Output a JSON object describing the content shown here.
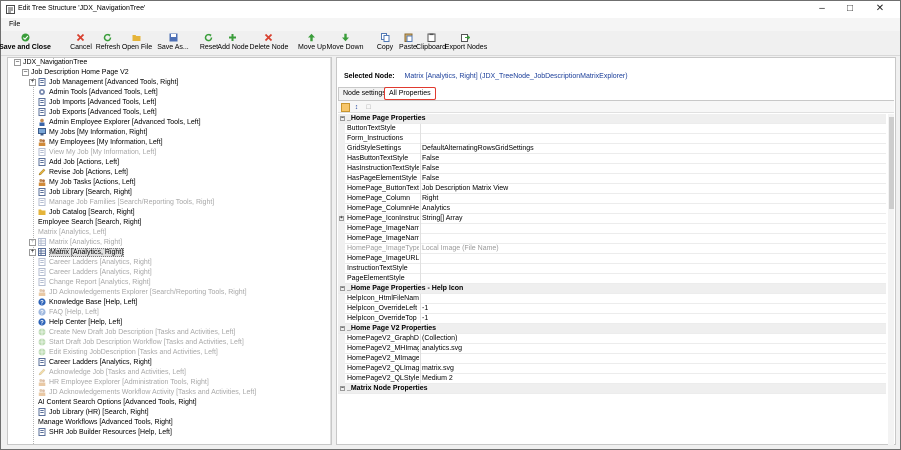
{
  "window": {
    "title": "Edit Tree Structure 'JDX_NavigationTree'"
  },
  "menu": {
    "file": "File"
  },
  "toolbar": [
    {
      "label": "Save and Close",
      "icon": "check-circle-icon",
      "color": "#3a9d3a",
      "bold": true
    },
    {
      "label": "Cancel",
      "icon": "x-icon",
      "color": "#d8412f"
    },
    {
      "label": "Refresh",
      "icon": "refresh-icon",
      "color": "#3a9d3a"
    },
    {
      "label": "Open File",
      "icon": "folder-icon",
      "color": "#e5b43a"
    },
    {
      "label": "Save As...",
      "icon": "floppy-icon",
      "color": "#4d6fb5"
    },
    {
      "label": "Reset",
      "icon": "refresh-icon",
      "color": "#3a9d3a"
    },
    {
      "label": "Add Node",
      "icon": "plus-icon",
      "color": "#3a9d3a"
    },
    {
      "label": "Delete Node",
      "icon": "x-icon",
      "color": "#d8412f"
    },
    {
      "label": "Move Up",
      "icon": "arrow-up-icon",
      "color": "#3a9d3a"
    },
    {
      "label": "Move Down",
      "icon": "arrow-down-icon",
      "color": "#3a9d3a"
    },
    {
      "label": "Copy",
      "icon": "copy-icon",
      "color": "#5078b4"
    },
    {
      "label": "Paste",
      "icon": "paste-icon",
      "color": "#5078b4"
    },
    {
      "label": "Clipboard",
      "icon": "clipboard-icon",
      "color": "#555555"
    },
    {
      "label": "Export Nodes",
      "icon": "export-icon",
      "color": "#555555"
    }
  ],
  "tree": {
    "root": "JDX_NavigationTree",
    "parent": "Job Description Home Page V2",
    "items": [
      {
        "label": "Job Management [Advanced Tools, Right]",
        "icon": "doc-icon",
        "expandable": true,
        "disabled": false
      },
      {
        "label": "Admin Tools [Advanced Tools, Left]",
        "icon": "gear-icon",
        "expandable": false,
        "disabled": false
      },
      {
        "label": "Job Imports [Advanced Tools, Left]",
        "icon": "doc-icon",
        "expandable": false,
        "disabled": false
      },
      {
        "label": "Job Exports [Advanced Tools, Left]",
        "icon": "doc-icon",
        "expandable": false,
        "disabled": false
      },
      {
        "label": "Admin Employee Explorer [Advanced Tools, Left]",
        "icon": "person-icon",
        "expandable": false,
        "disabled": false
      },
      {
        "label": "My Jobs [My Information, Right]",
        "icon": "monitor-icon",
        "expandable": false,
        "disabled": false
      },
      {
        "label": "My Employees [My Information, Left]",
        "icon": "people-icon",
        "expandable": false,
        "disabled": false
      },
      {
        "label": "View My Job [My Information, Left]",
        "icon": "doc-icon",
        "expandable": false,
        "disabled": true
      },
      {
        "label": "Add Job [Actions, Left]",
        "icon": "doc-icon",
        "expandable": false,
        "disabled": false
      },
      {
        "label": "Revise Job [Actions, Left]",
        "icon": "pencil-icon",
        "expandable": false,
        "disabled": false
      },
      {
        "label": "My Job Tasks [Actions, Left]",
        "icon": "people-icon",
        "expandable": false,
        "disabled": false
      },
      {
        "label": "Job Library [Search, Right]",
        "icon": "doc-icon",
        "expandable": false,
        "disabled": false
      },
      {
        "label": "Manage Job Families [Search/Reporting Tools, Right]",
        "icon": "doc-icon",
        "expandable": false,
        "disabled": true
      },
      {
        "label": "Job Catalog [Search, Right]",
        "icon": "folder-icon",
        "expandable": false,
        "disabled": false
      },
      {
        "label": "Employee Search [Search, Right]",
        "icon": "",
        "expandable": false,
        "disabled": false
      },
      {
        "label": "Matrix [Analytics, Left]",
        "icon": "",
        "expandable": false,
        "disabled": true
      },
      {
        "label": "Matrix [Analytics, Right]",
        "icon": "grid-icon",
        "expandable": true,
        "disabled": true
      },
      {
        "label": "Matrix [Analytics, Right]",
        "icon": "grid-icon",
        "expandable": true,
        "disabled": false,
        "selected": true
      },
      {
        "label": "Career Ladders [Analytics, Right]",
        "icon": "doc-icon",
        "expandable": false,
        "disabled": true
      },
      {
        "label": "Career Ladders [Analytics, Right]",
        "icon": "doc-icon",
        "expandable": false,
        "disabled": true
      },
      {
        "label": "Change Report [Analytics, Right]",
        "icon": "doc-icon",
        "expandable": false,
        "disabled": true
      },
      {
        "label": "JD Acknowledgements Explorer [Search/Reporting Tools, Right]",
        "icon": "people-icon",
        "expandable": false,
        "disabled": true
      },
      {
        "label": "Knowledge Base [Help, Left]",
        "icon": "help-icon",
        "expandable": false,
        "disabled": false
      },
      {
        "label": "FAQ [Help, Left]",
        "icon": "help-icon",
        "expandable": false,
        "disabled": true
      },
      {
        "label": "Help Center [Help, Left]",
        "icon": "help-icon",
        "expandable": false,
        "disabled": false
      },
      {
        "label": "Create New Draft Job Description [Tasks and Activities, Left]",
        "icon": "globe-icon",
        "expandable": false,
        "disabled": true
      },
      {
        "label": "Start Draft Job Description Workflow [Tasks and Activities, Left]",
        "icon": "globe-icon",
        "expandable": false,
        "disabled": true
      },
      {
        "label": "Edit Existing JobDescription [Tasks and Activities, Left]",
        "icon": "globe-icon",
        "expandable": false,
        "disabled": true
      },
      {
        "label": "Career Ladders [Analytics, Right]",
        "icon": "doc-icon",
        "expandable": false,
        "disabled": false
      },
      {
        "label": "Acknowledge Job [Tasks and Activities, Left]",
        "icon": "pencil-icon",
        "expandable": false,
        "disabled": true
      },
      {
        "label": "HR Employee Explorer [Administration Tools, Right]",
        "icon": "people-icon",
        "expandable": false,
        "disabled": true
      },
      {
        "label": "JD Acknowledgements Workflow Activity [Tasks and Activities, Left]",
        "icon": "people-icon",
        "expandable": false,
        "disabled": true
      },
      {
        "label": "AI Content Search Options [Advanced Tools, Right]",
        "icon": "",
        "expandable": false,
        "disabled": false
      },
      {
        "label": "Job Library (HR) [Search, Right]",
        "icon": "doc-icon",
        "expandable": false,
        "disabled": false
      },
      {
        "label": "Manage Workflows [Advanced Tools, Right]",
        "icon": "",
        "expandable": false,
        "disabled": false
      },
      {
        "label": "SHR Job Builder Resources [Help, Left]",
        "icon": "doc-icon",
        "expandable": false,
        "disabled": false
      }
    ]
  },
  "details": {
    "selected_label": "Selected Node:",
    "selected_value": "Matrix [Analytics, Right]  (JDX_TreeNode_JobDescriptionMatrixExplorer)",
    "tabs": [
      {
        "label": "Node settings",
        "active": false
      },
      {
        "label": "All Properties",
        "active": true
      }
    ],
    "property_tools": [
      "categorized-icon",
      "sort-alpha-icon",
      "property-pages-icon"
    ],
    "properties": [
      {
        "cat": true,
        "name": "_Home Page Properties"
      },
      {
        "name": "ButtonTextStyle",
        "value": ""
      },
      {
        "name": "Form_Instructions",
        "value": ""
      },
      {
        "name": "GridStyleSettings",
        "value": "DefaultAlternatingRowsGridSettings"
      },
      {
        "name": "HasButtonTextStyle",
        "value": "False"
      },
      {
        "name": "HasInstructionTextStyle",
        "value": "False"
      },
      {
        "name": "HasPageElementStyle",
        "value": "False"
      },
      {
        "name": "HomePage_ButtonText",
        "value": "Job Description Matrix View"
      },
      {
        "name": "HomePage_Column",
        "value": "Right"
      },
      {
        "name": "HomePage_ColumnHeadir",
        "value": "Analytics"
      },
      {
        "name": "HomePage_IconInstructio",
        "value": "String[] Array",
        "expandable": true
      },
      {
        "name": "HomePage_ImageName",
        "value": ""
      },
      {
        "name": "HomePage_ImageName_f",
        "value": ""
      },
      {
        "name": "HomePage_ImageType",
        "value": "Local Image (File Name)",
        "readonly": true
      },
      {
        "name": "HomePage_ImageURL",
        "value": ""
      },
      {
        "name": "InstructionTextStyle",
        "value": ""
      },
      {
        "name": "PageElementStyle",
        "value": ""
      },
      {
        "cat": true,
        "name": "_Home Page Properties - Help Icon"
      },
      {
        "name": "HelpIcon_HtmlFileName",
        "value": ""
      },
      {
        "name": "HelpIcon_OverrideLeft",
        "value": "-1"
      },
      {
        "name": "HelpIcon_OverrideTop",
        "value": "-1"
      },
      {
        "cat": true,
        "name": "_Home Page V2 Properties"
      },
      {
        "name": "HomePageV2_GraphData1",
        "value": "(Collection)"
      },
      {
        "name": "HomePageV2_MHImageN",
        "value": "analytics.svg"
      },
      {
        "name": "HomePageV2_MImageNar",
        "value": ""
      },
      {
        "name": "HomePageV2_QLImageNa",
        "value": "matrix.svg"
      },
      {
        "name": "HomePageV2_QLStyleTyp",
        "value": "Medium 2"
      },
      {
        "cat": true,
        "name": "_Matrix Node Properties"
      }
    ]
  },
  "colors": {
    "accent_link": "#1c3f9a",
    "tab_highlight": "#e03a2f",
    "disabled_text": "#a8a8a8"
  }
}
